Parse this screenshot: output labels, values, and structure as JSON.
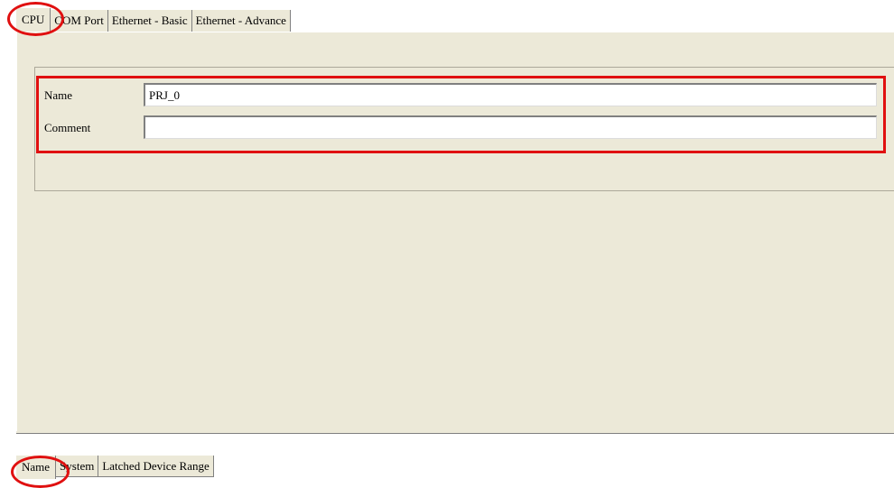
{
  "top_tabs": [
    {
      "label": "CPU"
    },
    {
      "label": "COM Port"
    },
    {
      "label": "Ethernet - Basic"
    },
    {
      "label": "Ethernet - Advance"
    }
  ],
  "form": {
    "name_label": "Name",
    "name_value": "PRJ_0",
    "comment_label": "Comment",
    "comment_value": ""
  },
  "bottom_tabs": [
    {
      "label": "Name"
    },
    {
      "label": "System"
    },
    {
      "label": "Latched Device Range"
    }
  ],
  "colors": {
    "panel_bg": "#ECE9D8",
    "annotation_red": "#E01010"
  }
}
